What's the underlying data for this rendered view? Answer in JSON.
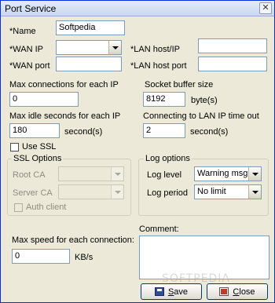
{
  "window": {
    "title": "Port Service",
    "close_glyph": "✕"
  },
  "fields": {
    "name": {
      "label": "*Name",
      "value": "Softpedia"
    },
    "wan_ip": {
      "label": "*WAN IP",
      "value": ""
    },
    "lan_host_ip": {
      "label": "*LAN host/IP",
      "value": ""
    },
    "wan_port": {
      "label": "*WAN port",
      "value": ""
    },
    "lan_host_port": {
      "label": "*LAN host port",
      "value": ""
    },
    "max_connections": {
      "label": "Max connections for each IP",
      "value": "0"
    },
    "socket_buffer": {
      "label": "Socket buffer size",
      "value": "8192",
      "unit": "byte(s)"
    },
    "max_idle": {
      "label": "Max idle seconds for each IP",
      "value": "180",
      "unit": "second(s)"
    },
    "lan_timeout": {
      "label": "Connecting to LAN IP time out",
      "value": "2",
      "unit": "second(s)"
    },
    "use_ssl": {
      "label": "Use SSL",
      "checked": false
    },
    "max_speed": {
      "label": "Max speed for each connection:",
      "value": "0",
      "unit": "KB/s"
    },
    "comment": {
      "label": "Comment:",
      "value": ""
    }
  },
  "ssl_options": {
    "title": "SSL Options",
    "root_ca": {
      "label": "Root CA",
      "value": ""
    },
    "server_ca": {
      "label": "Server CA",
      "value": ""
    },
    "auth_client": {
      "label": "Auth client",
      "checked": false
    }
  },
  "log_options": {
    "title": "Log options",
    "log_level": {
      "label": "Log level",
      "value": "Warning msg"
    },
    "log_period": {
      "label": "Log period",
      "value": "No limit"
    }
  },
  "buttons": {
    "save": {
      "label_first": "S",
      "label_rest": "ave"
    },
    "close": {
      "label_first": "C",
      "label_rest": "lose"
    }
  },
  "watermark": "SOFTPEDIA"
}
